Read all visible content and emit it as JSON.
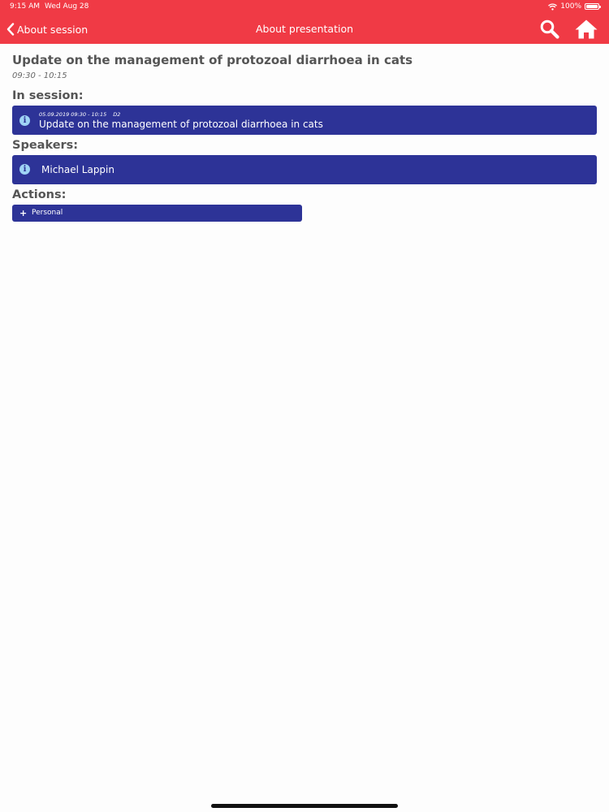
{
  "status_bar": {
    "time": "9:15 AM",
    "date": "Wed Aug 28",
    "battery": "100%",
    "battery_level": 1.0,
    "icons": [
      "wifi-icon",
      "battery-icon"
    ]
  },
  "nav": {
    "back_label": "About session",
    "title": "About presentation",
    "icons": [
      "chevron-left-icon",
      "search-icon",
      "home-icon"
    ]
  },
  "presentation": {
    "title": "Update on the management of protozoal diarrhoea in cats",
    "time": "09:30 - 10:15"
  },
  "in_session": {
    "heading": "In session:",
    "item": {
      "datetime": "05.09.2019 09:30 - 10:15",
      "room": "D2",
      "name": "Update on the management of protozoal diarrhoea in cats",
      "icon": "info-icon"
    }
  },
  "speakers": {
    "heading": "Speakers:",
    "items": [
      {
        "name": "Michael Lappin",
        "icon": "info-icon"
      }
    ]
  },
  "actions": {
    "heading": "Actions:",
    "items": [
      {
        "label": "Personal",
        "icon": "plus-icon"
      }
    ]
  },
  "colors": {
    "header": "#f03a45",
    "bar": "#2d3397",
    "info_icon": "#9fd3f5",
    "text": "#555555"
  }
}
